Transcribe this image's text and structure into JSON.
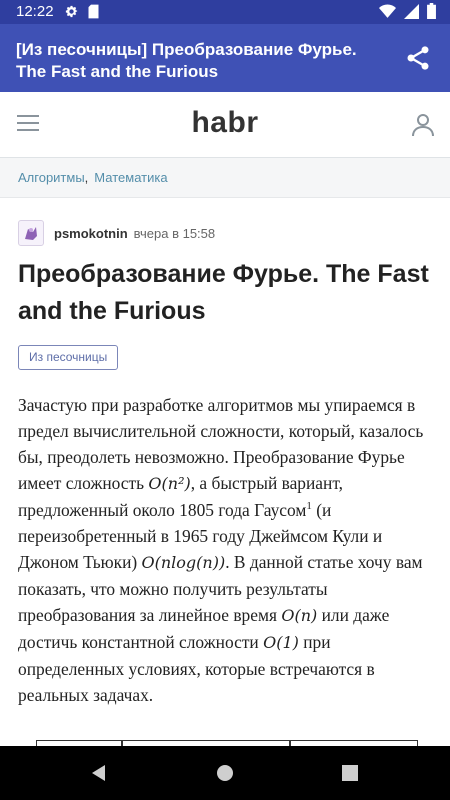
{
  "status_bar": {
    "time": "12:22",
    "left_icons": [
      "gear-icon",
      "sd-card-icon"
    ],
    "right_icons": [
      "wifi-icon",
      "signal-icon",
      "battery-icon"
    ]
  },
  "app_bar": {
    "title": "[Из песочницы] Преобразование Фурье. The Fast and the Furious",
    "share_icon": "share-icon",
    "color": "#3f51b5"
  },
  "site_header": {
    "logo": "habr"
  },
  "hubs": [
    {
      "label": "Алгоритмы"
    },
    {
      "label": "Математика"
    }
  ],
  "hub_separator": ",",
  "post": {
    "author": "psmokotnin",
    "date": "вчера в 15:58",
    "title": "Преобразование Фурье. The Fast and the Furious",
    "badge": "Из песочницы",
    "body": {
      "p1": "Зачастую при разработке алгоритмов мы упираемся в предел вычислительной сложности, который, казалось бы, преодолеть невозможно. Преобразование Фурье имеет сложность ",
      "m1": "O(n²)",
      "p2": ", а быстрый вариант, предложенный около 1805 года Гаусом",
      "sup1": "1",
      "p3": " (и переизобретенный в 1965 году Джеймсом Кули и Джоном Тьюки) ",
      "m2": "O(nlog(n))",
      "p4": ". В данной статье хочу вам показать, что можно получить результаты преобразования за линейное время ",
      "m3": "O(n)",
      "p5": " или даже достичь константной сложности ",
      "m4": "O(1)",
      "p6": " при определенных условиях, которые встречаются в реальных задачах."
    }
  },
  "nav_bar": {
    "buttons": [
      "back-icon",
      "home-icon",
      "recents-icon"
    ]
  },
  "colors": {
    "status_bar": "#2f3e9f",
    "app_bar": "#3f51b5",
    "hub_link": "#548eaa",
    "badge_border": "#7b86b8"
  }
}
